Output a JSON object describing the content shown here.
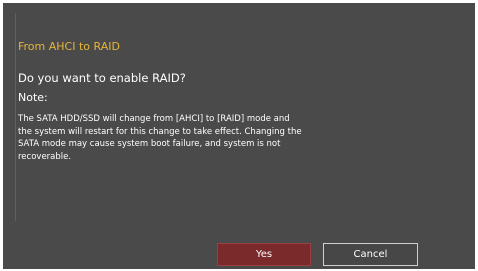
{
  "dialog": {
    "title": "From AHCI to RAID",
    "question": "Do you want to enable RAID?",
    "note_label": "Note:",
    "note_lines": [
      "The SATA HDD/SSD will change from [AHCI] to [RAID] mode and",
      "the system will restart for this change to take effect. Changing the",
      "SATA mode may cause system boot failure, and system is not",
      "recoverable."
    ],
    "yes_label": "Yes",
    "cancel_label": "Cancel"
  },
  "colors": {
    "dialog_background": "#4a4a4a",
    "title_accent": "#e5b43a",
    "yes_button": "#7a2a2a",
    "cancel_button_border": "#cfcfcf"
  }
}
